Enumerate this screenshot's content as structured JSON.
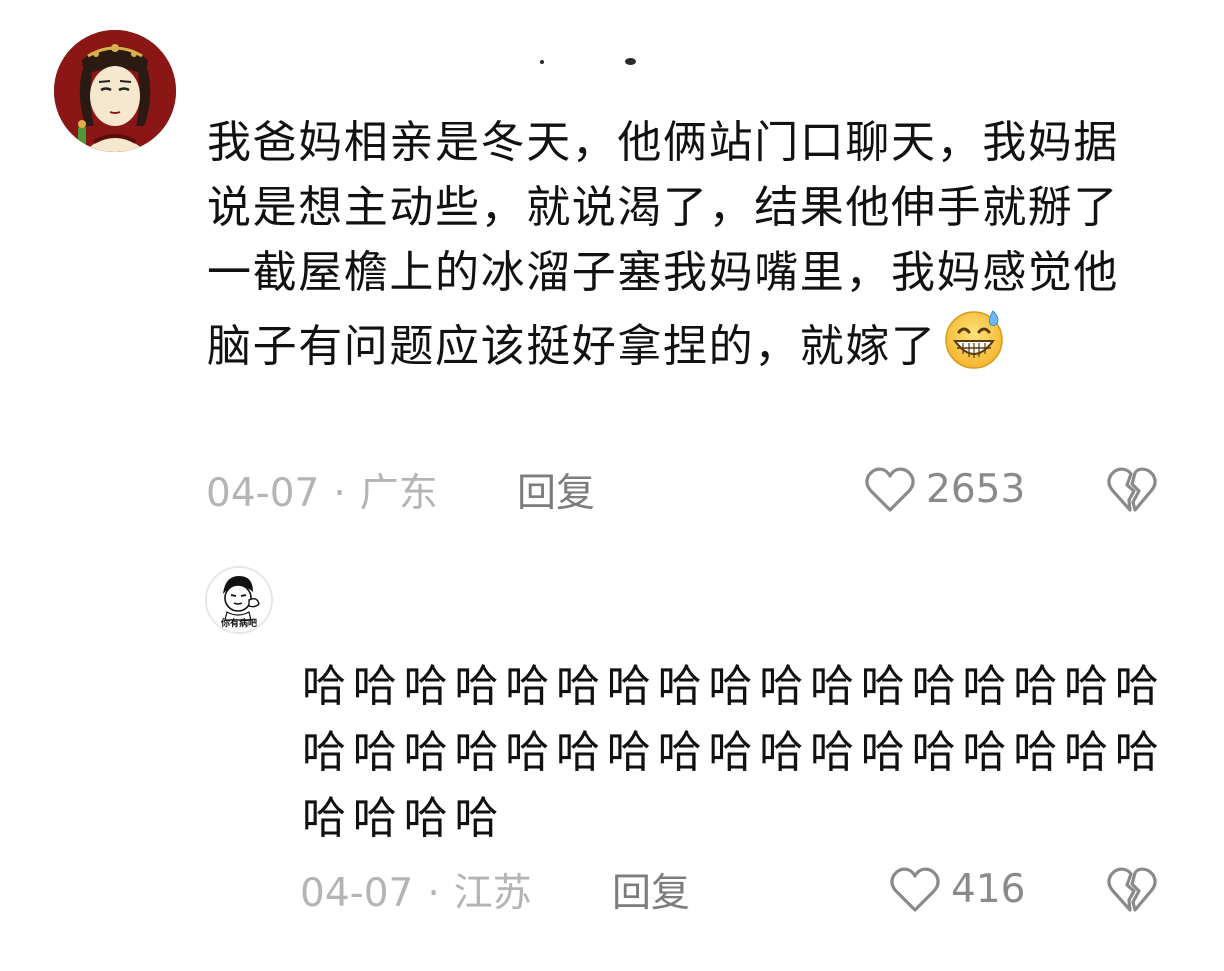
{
  "comments": [
    {
      "avatar": "avatar-cartoon-woman",
      "text": "我爸妈相亲是冬天，他俩站门口聊天，我妈据说是想主动些，就说渴了，结果他伸手就掰了一截屋檐上的冰溜子塞我妈嘴里，我妈感觉他脑子有问题应该挺好拿捏的，就嫁了",
      "emoji": "grinning-sweat-emoji",
      "date": "04-07",
      "separator": "·",
      "location": "广东",
      "reply_label": "回复",
      "likes": "2653",
      "like_icon": "heart-outline-icon",
      "dislike_icon": "broken-heart-icon"
    },
    {
      "avatar": "avatar-meme-boy",
      "avatar_caption": "你有病吧",
      "text": "哈哈哈哈哈哈哈哈哈哈哈哈哈哈哈哈哈哈哈哈哈哈哈哈哈哈哈哈哈哈哈哈哈哈哈哈哈哈",
      "date": "04-07",
      "separator": "·",
      "location": "江苏",
      "reply_label": "回复",
      "likes": "416",
      "like_icon": "heart-outline-icon",
      "dislike_icon": "broken-heart-icon"
    }
  ],
  "colors": {
    "meta": "#b4b4b4",
    "reply": "#7c7c7c",
    "count": "#8a8a8a",
    "avatar_bg": "#8a1616"
  }
}
